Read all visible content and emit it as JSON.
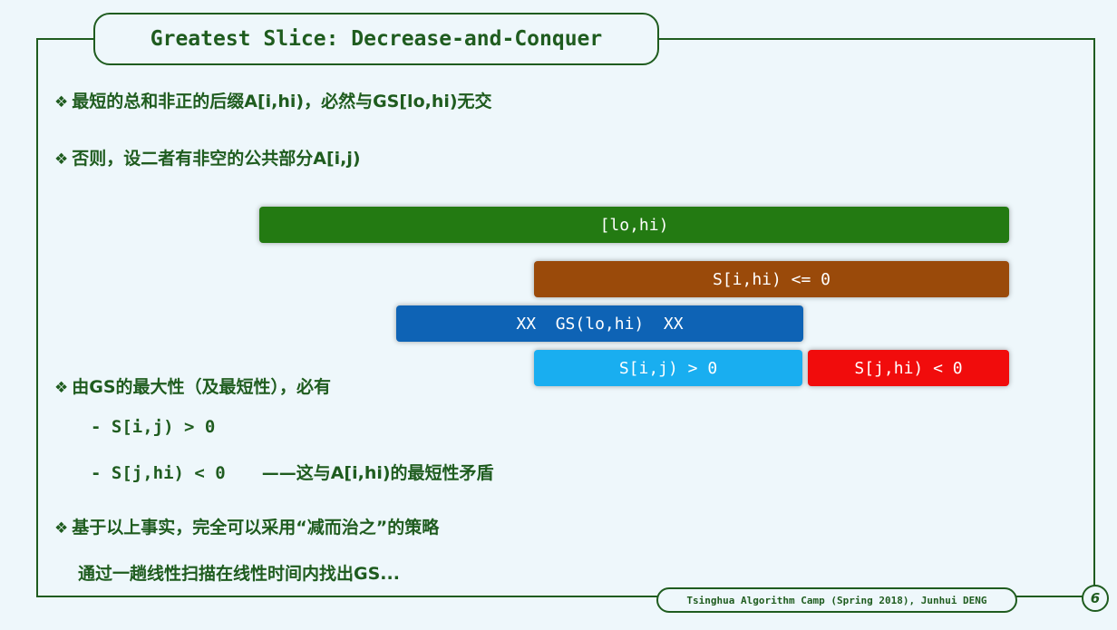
{
  "title": "Greatest Slice: Decrease-and-Conquer",
  "bullets": {
    "b1": "最短的总和非正的后缀A[i,hi)，必然与GS[lo,hi)无交",
    "b2": "否则，设二者有非空的公共部分A[i,j)",
    "b3": "由GS的最大性（及最短性），必有",
    "b4": "基于以上事实，完全可以采用“减而治之”的策略",
    "b4_cont": "通过一趟线性扫描在线性时间内找出GS..."
  },
  "sub": {
    "s1": "- S[i,j) > 0",
    "s2_code": "- S[j,hi) < 0",
    "s2_text": "——这与A[i,hi)的最短性矛盾"
  },
  "bars": {
    "lohi": "[lo,hi)",
    "sihi": "S[i,hi) <= 0",
    "gs": "XX  GS(lo,hi)  XX",
    "sij": "S[i,j) > 0",
    "sjhi": "S[j,hi) < 0"
  },
  "colors": {
    "green": "#237a12",
    "brown": "#9a4a0a",
    "blue": "#0e63b5",
    "lightblue": "#19aef0",
    "red": "#f10c0c",
    "frame": "#1f5c1f"
  },
  "footer": "Tsinghua Algorithm Camp (Spring 2018), Junhui DENG",
  "page_number": "6",
  "icons": {
    "bullet": "diamond-bullet-icon"
  }
}
